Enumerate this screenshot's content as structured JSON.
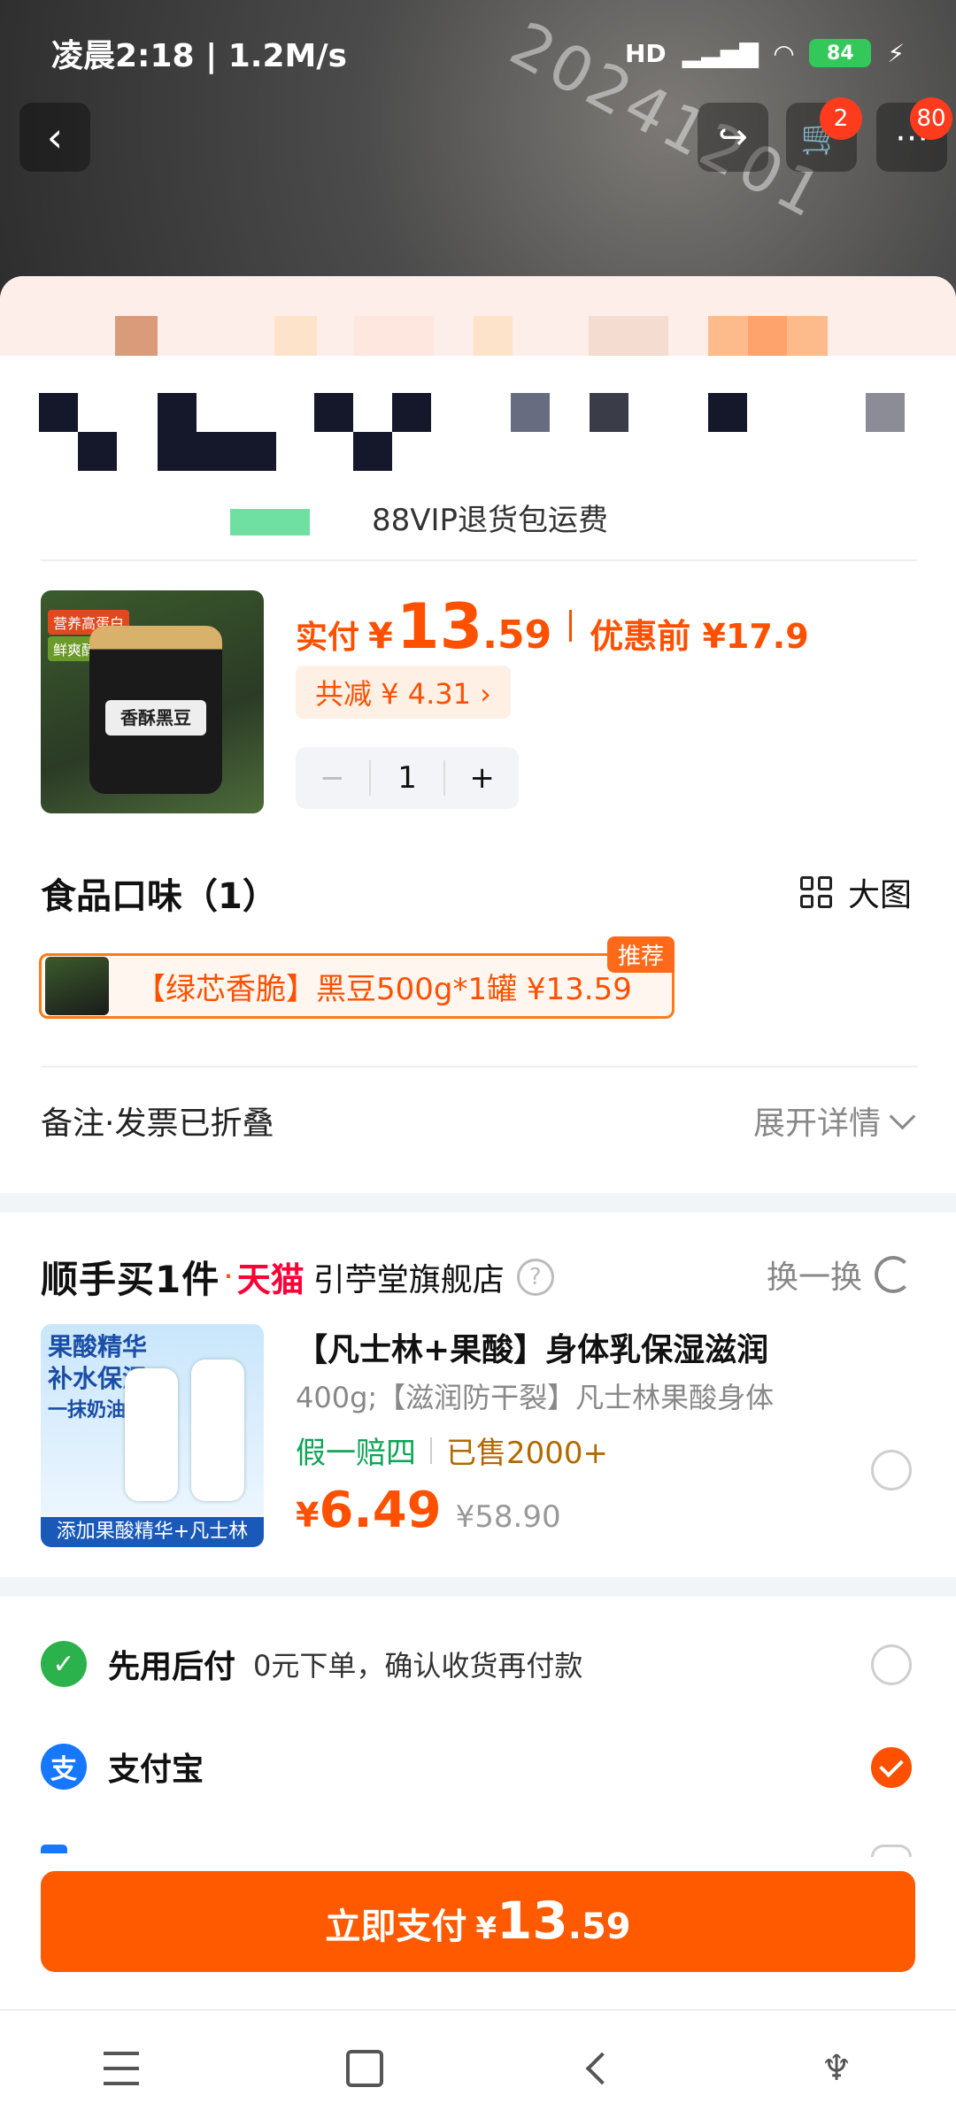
{
  "status_bar": {
    "time": "凌晨2:18 | 1.2M/s",
    "network": "HD",
    "battery": "84"
  },
  "header": {
    "cart_badge": "2",
    "more_badge": "80",
    "bg_text": "20241201"
  },
  "vip": {
    "text": "88VIP退货包运费"
  },
  "order_item": {
    "pay_label": "实付",
    "currency": "¥",
    "price_int": "13",
    "price_dec": ".59",
    "pre_label": "优惠前 ¥17.9",
    "discount": "共减 ¥ 4.31 ›",
    "qty_minus": "−",
    "qty": "1",
    "qty_plus": "+",
    "img_tag1": "营养高蛋白",
    "img_tag2": "鲜爽醇糖",
    "img_label": "香酥黑豆"
  },
  "flavor": {
    "title": "食品口味（1）",
    "big_image": "大图",
    "option": "【绿芯香脆】黑豆500g*1罐  ¥13.59",
    "tag": "推荐"
  },
  "remark": {
    "label": "备注·发票已折叠",
    "expand": "展开详情"
  },
  "shop": {
    "promo": "顺手买1件",
    "tmall": "天猫",
    "name": "引苧堂旗舰店",
    "help": "?",
    "swap": "换一换"
  },
  "addon": {
    "name": "【凡士林+果酸】身体乳保湿滋润",
    "spec": "400g;【滋润防干裂】凡士林果酸身体",
    "guarantee": "假一赔四",
    "sold": "已售2000+",
    "currency": "¥",
    "price": "6.49",
    "old_price": "¥58.90",
    "img_text1": "果酸精华",
    "img_text2": "补水保湿",
    "img_text3": "一抹奶油肌",
    "img_strip": "添加果酸精华+凡士林"
  },
  "payment": {
    "option1_name": "先用后付",
    "option1_sub": "0元下单，确认收货再付款",
    "option2_name": "支付宝",
    "alipay_icon": "支"
  },
  "pay_button": {
    "label": "立即支付",
    "currency": "¥",
    "int": "13",
    "dec": ".59"
  },
  "colors": {
    "accent": "#ff5000",
    "green": "#10a356"
  }
}
